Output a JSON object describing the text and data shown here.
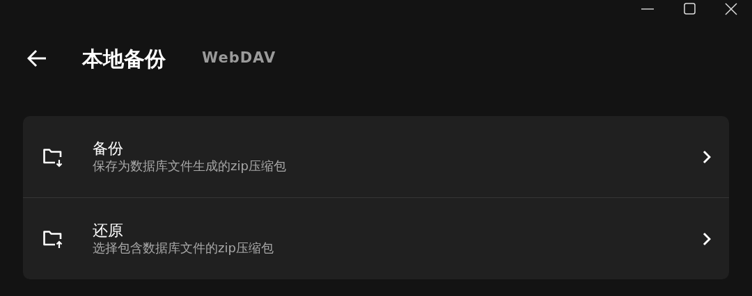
{
  "tabs": [
    {
      "label": "本地备份",
      "selected": true
    },
    {
      "label": "WebDAV",
      "selected": false
    }
  ],
  "items": [
    {
      "kind": "download",
      "title": "备份",
      "subtitle": "保存为数据库文件生成的zip压缩包"
    },
    {
      "kind": "upload",
      "title": "还原",
      "subtitle": "选择包含数据库文件的zip压缩包"
    }
  ]
}
